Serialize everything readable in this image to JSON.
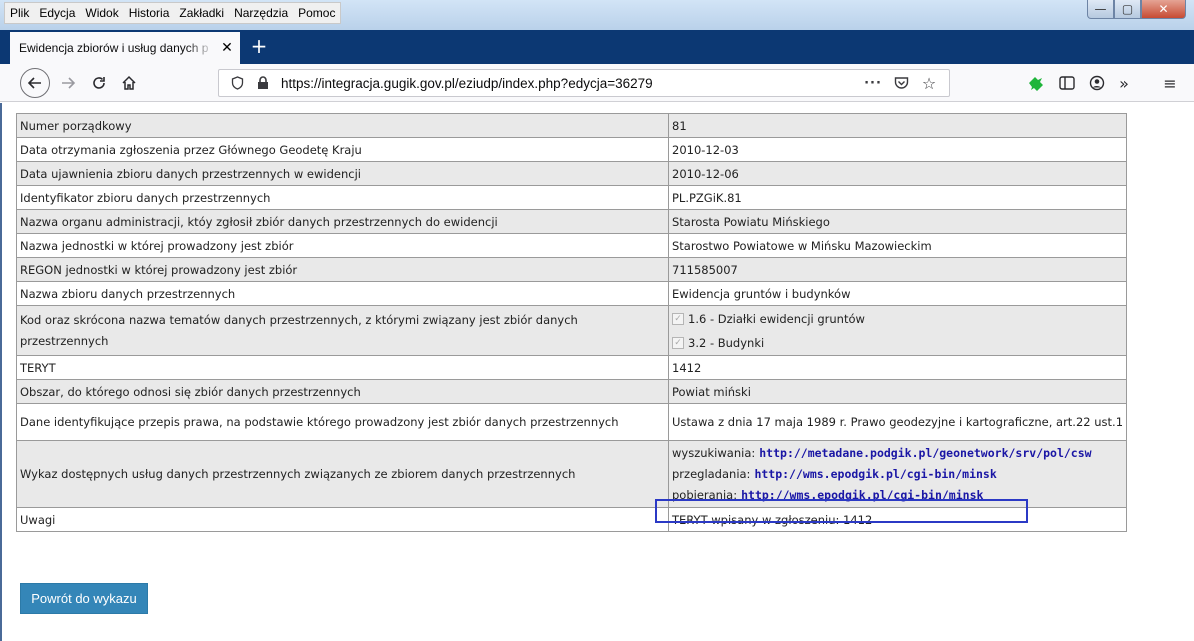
{
  "menu": [
    "Plik",
    "Edycja",
    "Widok",
    "Historia",
    "Zakładki",
    "Narzędzia",
    "Pomoc"
  ],
  "window_controls": {
    "minimize": "—",
    "maximize": "▢",
    "close": "✕"
  },
  "tab": {
    "title": "Ewidencja zbiorów i usług danych p",
    "close": "✕",
    "new_tab": "+"
  },
  "nav": {
    "url": "https://integracja.gugik.gov.pl/eziudp/index.php?edycja=36279",
    "icons": [
      "back-arrow-icon",
      "forward-arrow-icon",
      "reload-icon",
      "home-icon",
      "shield-icon",
      "lock-icon",
      "more-dots-icon",
      "pocket-icon",
      "bookmark-star-icon",
      "extension-icon",
      "sidebar-icon",
      "account-icon",
      "overflow-chevron-icon",
      "menu-hamburger-icon"
    ]
  },
  "accent_colors": {
    "titlebar": "#b9d1ea",
    "tabstrip": "#0c3873",
    "link": "#1a16a5",
    "highlight_box": "#2b39c5",
    "button": "#3486b8"
  },
  "record": {
    "rows": [
      {
        "label": "Numer porządkowy",
        "value": "81"
      },
      {
        "label": "Data otrzymania zgłoszenia przez Głównego Geodetę Kraju",
        "value": "2010-12-03"
      },
      {
        "label": "Data ujawnienia zbioru danych przestrzennych w ewidencji",
        "value": "2010-12-06"
      },
      {
        "label": "Identyfikator zbioru danych przestrzennych",
        "value": "PL.PZGiK.81"
      },
      {
        "label": "Nazwa organu administracji, któy zgłosił zbiór danych przestrzennych do ewidencji",
        "value": "Starosta Powiatu Mińskiego"
      },
      {
        "label": "Nazwa jednostki w której prowadzony jest zbiór",
        "value": "Starostwo Powiatowe w Mińsku Mazowieckim"
      },
      {
        "label": "REGON jednostki w której prowadzony jest zbiór",
        "value": "711585007"
      },
      {
        "label": "Nazwa zbioru danych przestrzennych",
        "value": "Ewidencja gruntów i budynków"
      },
      {
        "label": "Kod oraz skrócona nazwa tematów danych przestrzennych, z którymi związany jest zbiór danych przestrzennych",
        "themes": [
          "1.6 - Działki ewidencji gruntów",
          "3.2 - Budynki"
        ]
      },
      {
        "label": "TERYT",
        "value": "1412"
      },
      {
        "label": "Obszar, do którego odnosi się zbiór danych przestrzennych",
        "value": "Powiat miński"
      },
      {
        "label": "Dane identyfikujące przepis prawa, na podstawie którego prowadzony jest zbiór danych przestrzennych",
        "value": "Ustawa z dnia 17 maja 1989 r. Prawo geodezyjne i kartograficzne, art.22 ust.1"
      },
      {
        "label": "Wykaz dostępnych usług danych przestrzennych związanych ze zbiorem danych przestrzennych",
        "services": [
          {
            "type": "wyszukiwania:",
            "url": "http://metadane.podgik.pl/geonetwork/srv/pol/csw"
          },
          {
            "type": "przegladania:",
            "url": "http://wms.epodgik.pl/cgi-bin/minsk"
          },
          {
            "type": "pobierania:",
            "url": "http://wms.epodgik.pl/cgi-bin/minsk"
          }
        ]
      },
      {
        "label": "Uwagi",
        "value": "TERYT wpisany w zgłoszeniu: 1412"
      }
    ]
  },
  "back_button": "Powrót do wykazu"
}
